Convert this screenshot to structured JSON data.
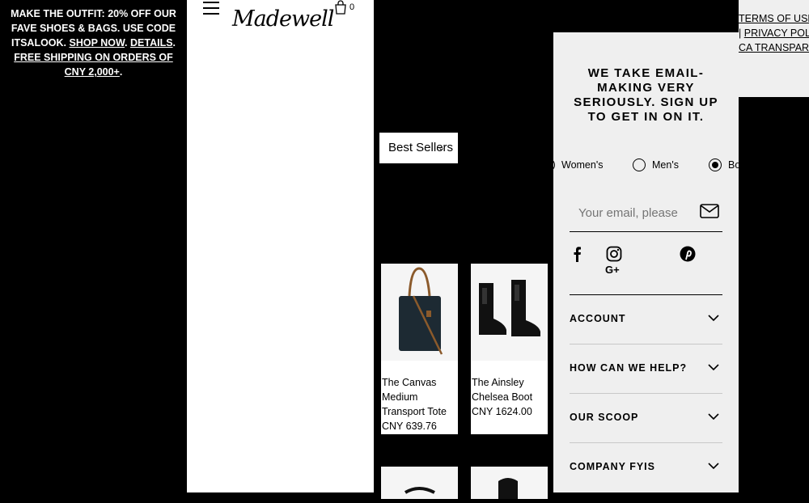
{
  "promo": {
    "line1": "MAKE THE OUTFIT: 20% OFF OUR FAVE SHOES & BAGS. USE CODE ITSALOOK.",
    "shop_now": "SHOP NOW",
    "details": "DETAILS",
    "shipping": "FREE SHIPPING ON ORDERS OF CNY 2,000+"
  },
  "header": {
    "logo": "Madewell",
    "cart_count": "0"
  },
  "filter": {
    "label": "Best Sellers"
  },
  "products": [
    {
      "name": "The Canvas Medium Transport Tote",
      "price": "CNY 639.76"
    },
    {
      "name": "The Ainsley Chelsea Boot",
      "price": "CNY 1624.00"
    }
  ],
  "footer": {
    "signup_heading": "WE TAKE EMAIL-MAKING VERY SERIOUSLY. SIGN UP TO GET IN ON IT.",
    "radios": [
      {
        "label": "Women's",
        "selected": false
      },
      {
        "label": "Men's",
        "selected": false
      },
      {
        "label": "Both",
        "selected": true
      }
    ],
    "email_placeholder": "Your email, please",
    "social": [
      "facebook-icon",
      "instagram-icon",
      "pinterest-icon",
      "google-plus-icon"
    ],
    "accordion": [
      "ACCOUNT",
      "HOW CAN WE HELP?",
      "OUR SCOOP",
      "COMPANY FYIS"
    ]
  },
  "legal": {
    "terms": "TERMS OF USE",
    "privacy": "PRIVACY POLICY",
    "ca": "CA TRANSPARENCY ACT"
  }
}
